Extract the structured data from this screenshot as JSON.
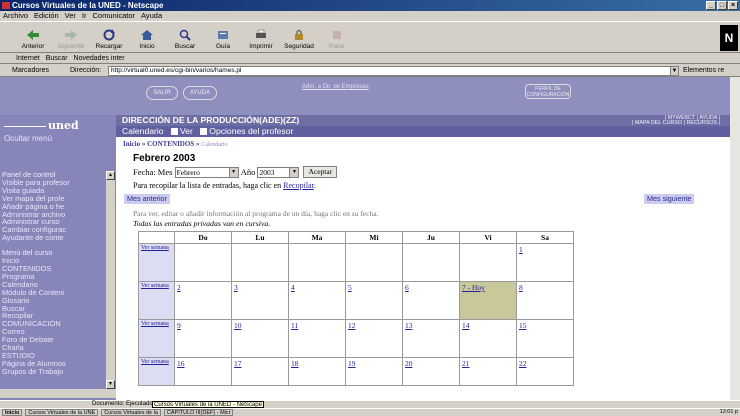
{
  "window": {
    "title": "Cursos Virtuales de la UNED - Netscape"
  },
  "menubar": [
    "Archivo",
    "Edición",
    "Ver",
    "Ir",
    "Comunicator",
    "Ayuda"
  ],
  "toolbar": [
    {
      "label": "Anterior",
      "icon": "back-arrow-icon",
      "enabled": true
    },
    {
      "label": "Siguiente",
      "icon": "forward-arrow-icon",
      "enabled": false
    },
    {
      "label": "Recargar",
      "icon": "reload-icon",
      "enabled": true
    },
    {
      "label": "Inicio",
      "icon": "home-icon",
      "enabled": true
    },
    {
      "label": "Buscar",
      "icon": "search-icon",
      "enabled": true
    },
    {
      "label": "Guía",
      "icon": "guide-icon",
      "enabled": true
    },
    {
      "label": "Imprimir",
      "icon": "print-icon",
      "enabled": true
    },
    {
      "label": "Seguridad",
      "icon": "lock-icon",
      "enabled": true
    },
    {
      "label": "Parar",
      "icon": "stop-icon",
      "enabled": false
    }
  ],
  "personal_toolbar": [
    "Internet",
    "Buscar",
    "Novedades inter"
  ],
  "location": {
    "bookmarks_label": "Marcadores",
    "direccion_label": "Dirección:",
    "url": "http://virtual0.uned.es/cgi-bin/varios/hames.pl",
    "related_label": "Elementos re"
  },
  "page": {
    "top_buttons": {
      "salir": "SALIR",
      "ayuda": "AYUDA"
    },
    "admin_link": "Adm. a Dir. de Empresas",
    "perfil_button": "PERFIL DE CONFIGURACIÓN",
    "logo": "uned",
    "ocultar_menu": "Ocultar menú",
    "header_title": "DIRECCIÓN DE LA PRODUCCIÓN(ADE)(ZZ)",
    "header_links_line1": "| MYWEBCT | AYUDA |",
    "header_links_line2": "| MAPA DEL CURSO | RECURSOS |",
    "subnav": {
      "calendario": "Calendario",
      "ver": "Ver",
      "opciones": "Opciones del profesor"
    },
    "breadcrumb": {
      "inicio": "Inicio",
      "contenidos": "CONTENIDOS",
      "current": "Calendario"
    },
    "left_nav": [
      {
        "label": "Panel de control",
        "header": true
      },
      {
        "label": "Visible para profesor",
        "header": false
      },
      {
        "label": "Visita guiada",
        "header": false
      },
      {
        "label": "Ver mapa del profe",
        "header": false
      },
      {
        "label": "Añadir página o he",
        "header": false
      },
      {
        "label": "Administrar archivo",
        "header": false
      },
      {
        "label": "Administrar curso",
        "header": false
      },
      {
        "label": "Cambiar configurac",
        "header": false
      },
      {
        "label": "Ayudante de conte",
        "header": false
      },
      {
        "label": "",
        "header": false
      },
      {
        "label": "Menú del curso",
        "header": true
      },
      {
        "label": "Inicio",
        "header": false
      },
      {
        "label": "CONTENIDOS",
        "header": false
      },
      {
        "label": "Programa",
        "header": false
      },
      {
        "label": "Calendario",
        "header": false
      },
      {
        "label": "Módulo de Conteni",
        "header": false
      },
      {
        "label": "Glosario",
        "header": false
      },
      {
        "label": "Buscar",
        "header": false
      },
      {
        "label": "Recopilar",
        "header": false
      },
      {
        "label": "COMUNICACIÓN",
        "header": false
      },
      {
        "label": "Correo",
        "header": false
      },
      {
        "label": "Foro de Debate",
        "header": false
      },
      {
        "label": "Charla",
        "header": false
      },
      {
        "label": "ESTUDIO",
        "header": false
      },
      {
        "label": "Página de Alumnos",
        "header": false
      },
      {
        "label": "Grupos de Trabajo",
        "header": false
      }
    ],
    "calendar": {
      "month_title": "Febrero 2003",
      "fecha_label": "Fecha:",
      "mes_label": "Mes",
      "month_selected": "Febrero",
      "anio_label": "Año",
      "year_selected": "2003",
      "aceptar": "Aceptar",
      "recopilar_text": "Para recopilar la lista de entradas, haga clic en",
      "recopilar_link": "Recopilar",
      "prev": "Mes anterior",
      "next": "Mes siguiente",
      "help_text": "Para ver, editar o añadir información al programa de un día, haga clic en su fecha.",
      "private_note": "Todas las entradas privadas van en cursiva.",
      "day_headers": [
        "Do",
        "Lu",
        "Ma",
        "Mi",
        "Ju",
        "Vi",
        "Sa"
      ],
      "ver_semana": "Ver semana",
      "weeks": [
        [
          "",
          "",
          "",
          "",
          "",
          "",
          "1"
        ],
        [
          "2",
          "3",
          "4",
          "5",
          "6",
          "7 - Hoy",
          "8"
        ],
        [
          "9",
          "10",
          "11",
          "12",
          "13",
          "14",
          "15"
        ],
        [
          "16",
          "17",
          "18",
          "19",
          "20",
          "21",
          "22"
        ]
      ]
    }
  },
  "status": {
    "text": "Documento: Ejecutado",
    "tooltip": "Cursos Virtuales de la UNED - Netscape"
  },
  "taskbar": {
    "start": "Inicio",
    "items": [
      "Cursos Virtuales de la UNE",
      "Cursos Virtuales de la",
      "CAPITULO III(DEF) - Micr"
    ],
    "clock": "12:01 p"
  }
}
